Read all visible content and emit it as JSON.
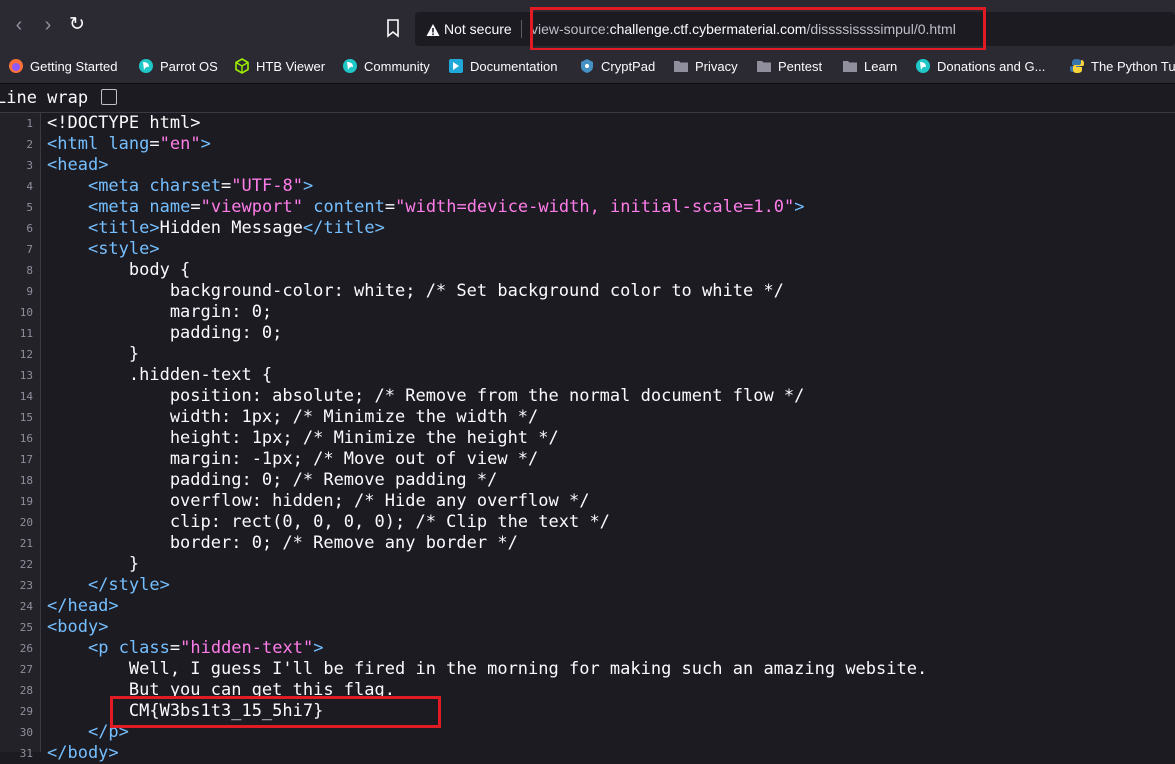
{
  "browser": {
    "security_label": "Not secure",
    "url_prefix": "view-source:",
    "url_host": "challenge.ctf.cybermaterial.com",
    "url_path": "/dissssissssimpul/0.html"
  },
  "bookmarks": [
    {
      "label": "Getting Started",
      "icon": "firefox-icon"
    },
    {
      "label": "Parrot OS",
      "icon": "parrot-icon"
    },
    {
      "label": "HTB Viewer",
      "icon": "cube-icon"
    },
    {
      "label": "Community",
      "icon": "parrot-icon"
    },
    {
      "label": "Documentation",
      "icon": "docs-icon"
    },
    {
      "label": "CryptPad",
      "icon": "cryptpad-icon"
    },
    {
      "label": "Privacy",
      "icon": "folder-icon"
    },
    {
      "label": "Pentest",
      "icon": "folder-icon"
    },
    {
      "label": "Learn",
      "icon": "folder-icon"
    },
    {
      "label": "Donations and G...",
      "icon": "parrot-icon"
    },
    {
      "label": "The Python Tu",
      "icon": "python-icon"
    }
  ],
  "viewer": {
    "line_wrap_label": "Line wrap",
    "line_wrap_checked": false
  },
  "source_lines": [
    "<!DOCTYPE html>",
    "<html lang=\"en\">",
    "<head>",
    "    <meta charset=\"UTF-8\">",
    "    <meta name=\"viewport\" content=\"width=device-width, initial-scale=1.0\">",
    "    <title>Hidden Message</title>",
    "    <style>",
    "        body {",
    "            background-color: white; /* Set background color to white */",
    "            margin: 0;",
    "            padding: 0;",
    "        }",
    "        .hidden-text {",
    "            position: absolute; /* Remove from the normal document flow */",
    "            width: 1px; /* Minimize the width */",
    "            height: 1px; /* Minimize the height */",
    "            margin: -1px; /* Move out of view */",
    "            padding: 0; /* Remove padding */",
    "            overflow: hidden; /* Hide any overflow */",
    "            clip: rect(0, 0, 0, 0); /* Clip the text */",
    "            border: 0; /* Remove any border */",
    "        }",
    "    </style>",
    "</head>",
    "<body>",
    "    <p class=\"hidden-text\">",
    "        Well, I guess I'll be fired in the morning for making such an amazing website.",
    "        But you can get this flag.",
    "        CM{W3bs1t3_15_5hi7}",
    "    </p>",
    "</body>"
  ],
  "colors": {
    "highlight_box": "#e01b24",
    "tag": "#75bfff",
    "string": "#ff7de9"
  }
}
